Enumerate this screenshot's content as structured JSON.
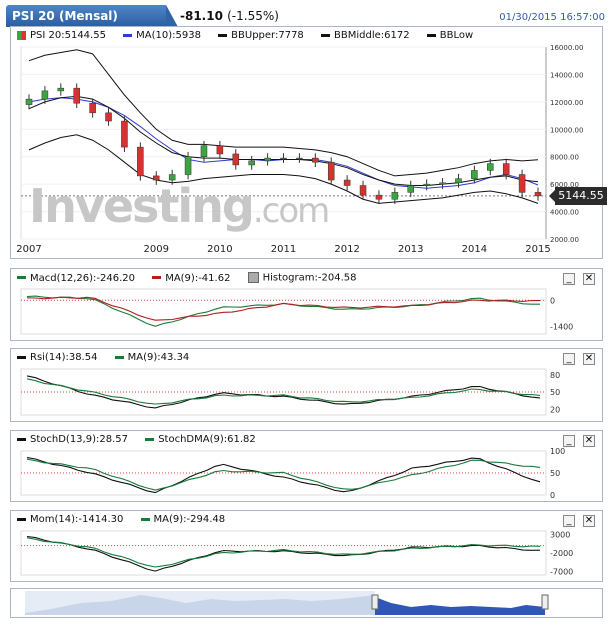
{
  "header": {
    "title": "PSI 20 (Mensal)",
    "change": "-81.10",
    "change_pct": "(-1.55%)",
    "datetime": "01/30/2015 16:57:00"
  },
  "main_chart": {
    "legend": [
      {
        "label": "PSI 20:5144.55",
        "color": "#2a8f3a",
        "swatch": "flag"
      },
      {
        "label": "MA(10):5938",
        "color": "#2c3bd1"
      },
      {
        "label": "BBUpper:7778",
        "color": "#111111"
      },
      {
        "label": "BBMiddle:6172",
        "color": "#111111"
      },
      {
        "label": "BBLow",
        "color": "#111111"
      }
    ],
    "price_label": "5144.55",
    "watermark": "Investing",
    "watermark_suffix": ".com",
    "y_ticks": [
      "16000.00",
      "14000.00",
      "12000.00",
      "10000.00",
      "8000.00",
      "6000.00",
      "4000.00",
      "2000.00"
    ],
    "x_ticks": [
      "2007",
      "2009",
      "2010",
      "2011",
      "2012",
      "2013",
      "2014",
      "2015"
    ]
  },
  "macd_panel": {
    "legend": [
      {
        "label": "Macd(12,26):-246.20",
        "color": "#1a7a3a"
      },
      {
        "label": "MA(9):-41.62",
        "color": "#b11f1f"
      },
      {
        "label": "Histogram:-204.58",
        "color": "#999999",
        "swatch": "box"
      }
    ],
    "y_ticks": [
      "0",
      "-1400"
    ]
  },
  "rsi_panel": {
    "legend": [
      {
        "label": "Rsi(14):38.54",
        "color": "#111111"
      },
      {
        "label": "MA(9):43.34",
        "color": "#1a7a3a"
      }
    ],
    "y_ticks": [
      "80",
      "50",
      "20"
    ]
  },
  "stoch_panel": {
    "legend": [
      {
        "label": "StochD(13,9):28.57",
        "color": "#111111"
      },
      {
        "label": "StochDMA(9):61.82",
        "color": "#1a7a3a"
      }
    ],
    "y_ticks": [
      "100",
      "50",
      "0"
    ]
  },
  "mom_panel": {
    "legend": [
      {
        "label": "Mom(14):-1414.30",
        "color": "#111111"
      },
      {
        "label": "MA(9):-294.48",
        "color": "#1a7a3a"
      }
    ],
    "y_ticks": [
      "3000",
      "-2000",
      "-7000"
    ]
  },
  "buttons": {
    "minimize": "_",
    "close": "✕"
  },
  "chart_data": [
    {
      "type": "candlestick",
      "title": "PSI 20 (Mensal)",
      "x": [
        "2007-01",
        "2007-04",
        "2007-07",
        "2007-10",
        "2008-01",
        "2008-04",
        "2008-07",
        "2008-10",
        "2009-01",
        "2009-04",
        "2009-07",
        "2009-10",
        "2010-01",
        "2010-04",
        "2010-07",
        "2010-10",
        "2011-01",
        "2011-04",
        "2011-07",
        "2011-10",
        "2012-01",
        "2012-04",
        "2012-07",
        "2012-10",
        "2013-01",
        "2013-04",
        "2013-07",
        "2013-10",
        "2014-01",
        "2014-04",
        "2014-07",
        "2014-10",
        "2015-01"
      ],
      "close": [
        12200,
        12800,
        13000,
        11900,
        11200,
        10600,
        8700,
        6600,
        6300,
        6700,
        8000,
        8800,
        8200,
        7400,
        7700,
        7900,
        7900,
        7900,
        7600,
        6300,
        5900,
        5200,
        4900,
        5400,
        5900,
        6000,
        6100,
        6400,
        7000,
        7500,
        6700,
        5400,
        5144.55
      ],
      "series": [
        {
          "name": "MA(10)",
          "values": [
            12000,
            12200,
            12300,
            12200,
            12000,
            11600,
            11000,
            10200,
            9300,
            8500,
            7800,
            7600,
            7700,
            7800,
            7800,
            7700,
            7800,
            7800,
            7800,
            7600,
            7300,
            6800,
            6300,
            5900,
            5800,
            5700,
            5800,
            5900,
            6100,
            6500,
            6700,
            6400,
            5938
          ]
        },
        {
          "name": "BBUpper",
          "values": [
            15000,
            15400,
            15600,
            15800,
            15500,
            14000,
            12500,
            11200,
            10000,
            9200,
            8900,
            8900,
            8800,
            8700,
            8700,
            8700,
            8700,
            8600,
            8500,
            8300,
            8000,
            7500,
            7000,
            6600,
            6700,
            6800,
            7000,
            7200,
            7500,
            7700,
            7800,
            7700,
            7778
          ]
        },
        {
          "name": "BBMiddle",
          "values": [
            11500,
            12000,
            12300,
            12400,
            12200,
            11600,
            10800,
            9800,
            9000,
            8300,
            8000,
            7900,
            7900,
            7800,
            7800,
            7800,
            7800,
            7800,
            7700,
            7500,
            7200,
            6700,
            6300,
            6000,
            5900,
            5900,
            6000,
            6100,
            6300,
            6500,
            6600,
            6300,
            6172
          ]
        },
        {
          "name": "BBLow",
          "values": [
            8500,
            9000,
            9400,
            9600,
            9200,
            8500,
            7600,
            6700,
            6300,
            6100,
            6200,
            6400,
            6500,
            6600,
            6700,
            6700,
            6700,
            6600,
            6400,
            6000,
            5500,
            4900,
            4600,
            4700,
            4800,
            4900,
            5000,
            5200,
            5400,
            5500,
            5300,
            5000,
            4600
          ]
        }
      ],
      "ylim": [
        2000,
        16000
      ],
      "y_scale": "linear"
    },
    {
      "type": "line",
      "title": "Macd(12,26)",
      "x": [
        "2007",
        "2008",
        "2009",
        "2010",
        "2011",
        "2012",
        "2013",
        "2014",
        "2015"
      ],
      "series": [
        {
          "name": "Macd(12,26)",
          "values": [
            200,
            100,
            -1400,
            -400,
            -200,
            -500,
            -300,
            100,
            -246.2
          ]
        },
        {
          "name": "MA(9)",
          "values": [
            100,
            150,
            -1100,
            -700,
            -200,
            -400,
            -300,
            0,
            -41.62
          ]
        }
      ],
      "ylim": [
        -1800,
        600
      ]
    },
    {
      "type": "line",
      "title": "Rsi(14)",
      "x": [
        "2007",
        "2008",
        "2009",
        "2010",
        "2011",
        "2012",
        "2013",
        "2014",
        "2015"
      ],
      "series": [
        {
          "name": "Rsi(14)",
          "values": [
            78,
            45,
            22,
            48,
            42,
            28,
            42,
            60,
            38.54
          ]
        },
        {
          "name": "MA(9)",
          "values": [
            72,
            50,
            28,
            44,
            44,
            32,
            40,
            55,
            43.34
          ]
        }
      ],
      "ylim": [
        10,
        90
      ]
    },
    {
      "type": "line",
      "title": "StochD(13,9)",
      "x": [
        "2007",
        "2008",
        "2009",
        "2010",
        "2011",
        "2012",
        "2013",
        "2014",
        "2015"
      ],
      "series": [
        {
          "name": "StochD(13,9)",
          "values": [
            85,
            50,
            5,
            70,
            40,
            5,
            60,
            85,
            28.57
          ]
        },
        {
          "name": "StochDMA(9)",
          "values": [
            80,
            60,
            10,
            55,
            50,
            10,
            45,
            80,
            61.82
          ]
        }
      ],
      "ylim": [
        0,
        100
      ]
    },
    {
      "type": "line",
      "title": "Mom(14)",
      "x": [
        "2007",
        "2008",
        "2009",
        "2010",
        "2011",
        "2012",
        "2013",
        "2014",
        "2015"
      ],
      "series": [
        {
          "name": "Mom(14)",
          "values": [
            2500,
            -1000,
            -7000,
            -1500,
            -1500,
            -2800,
            -500,
            0,
            -1414.3
          ]
        },
        {
          "name": "MA(9)",
          "values": [
            2000,
            -500,
            -6000,
            -2000,
            -1200,
            -2500,
            -800,
            200,
            -294.48
          ]
        }
      ],
      "ylim": [
        -8000,
        4000
      ]
    }
  ]
}
